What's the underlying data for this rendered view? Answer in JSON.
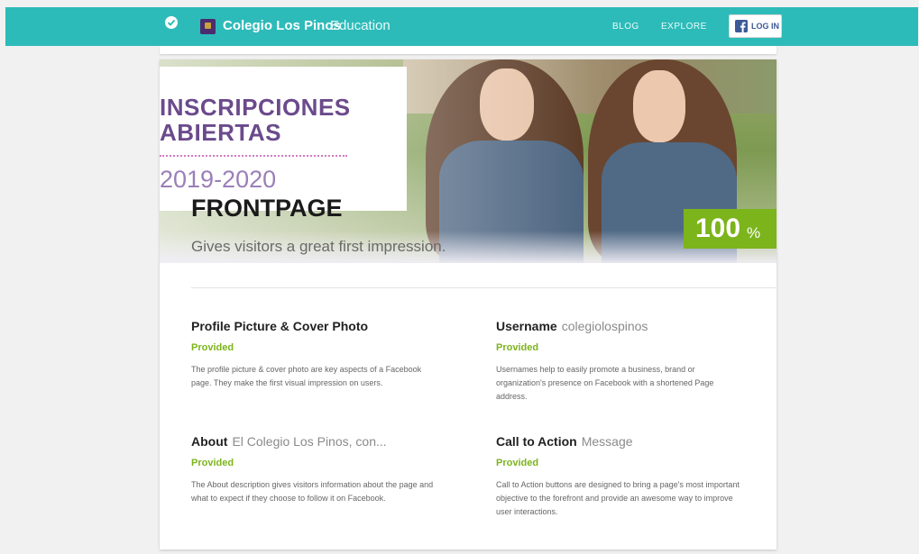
{
  "header": {
    "brand_name": "Colegio Los Pinos",
    "brand_category": "Education",
    "nav": [
      "BLOG",
      "EXPLORE"
    ],
    "login_label": "LOG IN",
    "accent_color": "#2dbbb9"
  },
  "hero": {
    "banner_line1": "INSCRIPCIONES",
    "banner_line2": "ABIERTAS",
    "banner_year": "2019-2020",
    "section_title": "FRONTPAGE",
    "section_subtitle": "Gives visitors a great first impression.",
    "score_value": "100",
    "score_unit": "%",
    "score_color": "#7cb41c"
  },
  "items": [
    {
      "title": "Profile Picture & Cover Photo",
      "extra": "",
      "status": "Provided",
      "description": "The profile picture & cover photo are key aspects of a Facebook page. They make the first visual impression on users."
    },
    {
      "title": "Username",
      "extra": "colegiolospinos",
      "status": "Provided",
      "description": "Usernames help to easily promote a business, brand or organization's presence on Facebook with a shortened Page address."
    },
    {
      "title": "About",
      "extra": "El Colegio Los Pinos, con...",
      "status": "Provided",
      "description": "The About description gives visitors information about the page and what to expect if they choose to follow it on Facebook."
    },
    {
      "title": "Call to Action",
      "extra": "Message",
      "status": "Provided",
      "description": "Call to Action buttons are designed to bring a page's most important objective to the forefront and provide an awesome way to improve user interactions."
    }
  ]
}
